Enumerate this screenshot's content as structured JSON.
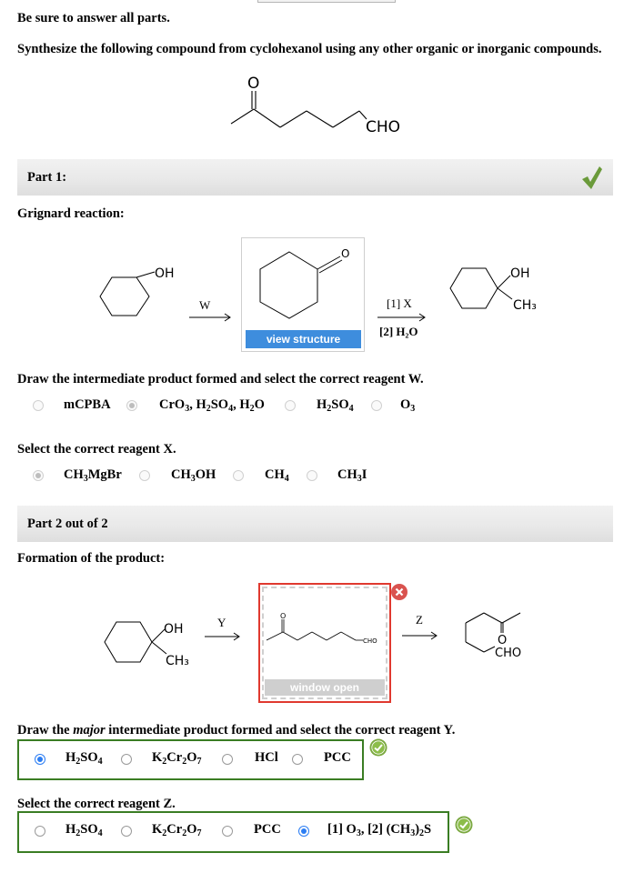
{
  "header": {
    "instruction": "Be sure to answer all parts.",
    "question": "Synthesize the following compound from cyclohexanol using any other organic or inorganic compounds.",
    "target_compound": {
      "carbonyl_label": "O",
      "aldehyde_label": "CHO",
      "name": "6-oxoheptanal"
    }
  },
  "part1": {
    "title": "Part 1:",
    "status": "correct",
    "subtitle": "Grignard reaction:",
    "starting_material": {
      "label": "OH",
      "name": "cyclohexanol"
    },
    "arrow_w_label": "W",
    "intermediate": {
      "carbonyl_label": "O",
      "name": "cyclohexanone",
      "button": "view structure"
    },
    "arrow_x_label_top": "[1] X",
    "arrow_x_label_bottom": "[2] H₂O",
    "product": {
      "oh_label": "OH",
      "ch3_label": "CH₃",
      "name": "1-methylcyclohexanol"
    },
    "question_w": "Draw the intermediate product formed and select the correct reagent W.",
    "options_w": [
      {
        "label": "mCPBA",
        "selected": false
      },
      {
        "label": "CrO₃, H₂SO₄, H₂O",
        "selected": true
      },
      {
        "label": "H₂SO₄",
        "selected": false
      },
      {
        "label": "O₃",
        "selected": false
      }
    ],
    "question_x": "Select the correct reagent X.",
    "options_x": [
      {
        "label": "CH₃MgBr",
        "selected": true
      },
      {
        "label": "CH₃OH",
        "selected": false
      },
      {
        "label": "CH₄",
        "selected": false
      },
      {
        "label": "CH₃I",
        "selected": false
      }
    ]
  },
  "part2": {
    "title": "Part 2 out of 2",
    "subtitle": "Formation of the product:",
    "starting_material": {
      "oh_label": "OH",
      "ch3_label": "CH₃"
    },
    "arrow_y_label": "Y",
    "intermediate": {
      "carbonyl_label": "O",
      "aldehyde_label": "CHO",
      "button": "window open",
      "close_icon": "x"
    },
    "arrow_z_label": "Z",
    "product": {
      "carbonyl_label": "O",
      "aldehyde_label": "CHO"
    },
    "question_y_prefix": "Draw the ",
    "question_y_emph": "major",
    "question_y_suffix": " intermediate product formed and select the correct reagent Y.",
    "options_y": [
      {
        "label": "H₂SO₄",
        "selected": true
      },
      {
        "label": "K₂Cr₂O₇",
        "selected": false
      },
      {
        "label": "HCl",
        "selected": false
      },
      {
        "label": "PCC",
        "selected": false
      }
    ],
    "question_z": "Select the correct reagent Z.",
    "options_z": [
      {
        "label": "H₂SO₄",
        "selected": false
      },
      {
        "label": "K₂Cr₂O₇",
        "selected": false
      },
      {
        "label": "PCC",
        "selected": false
      },
      {
        "label": "[1] O₃, [2] (CH₃)₂S",
        "selected": true
      }
    ],
    "status_y": "correct",
    "status_z": "correct"
  },
  "colors": {
    "correct_green": "#6a9a3a",
    "radio_blue": "#2b7df3",
    "box_green": "#3a7d23",
    "button_blue": "#3e8ddd",
    "error_red": "#e0392f"
  }
}
